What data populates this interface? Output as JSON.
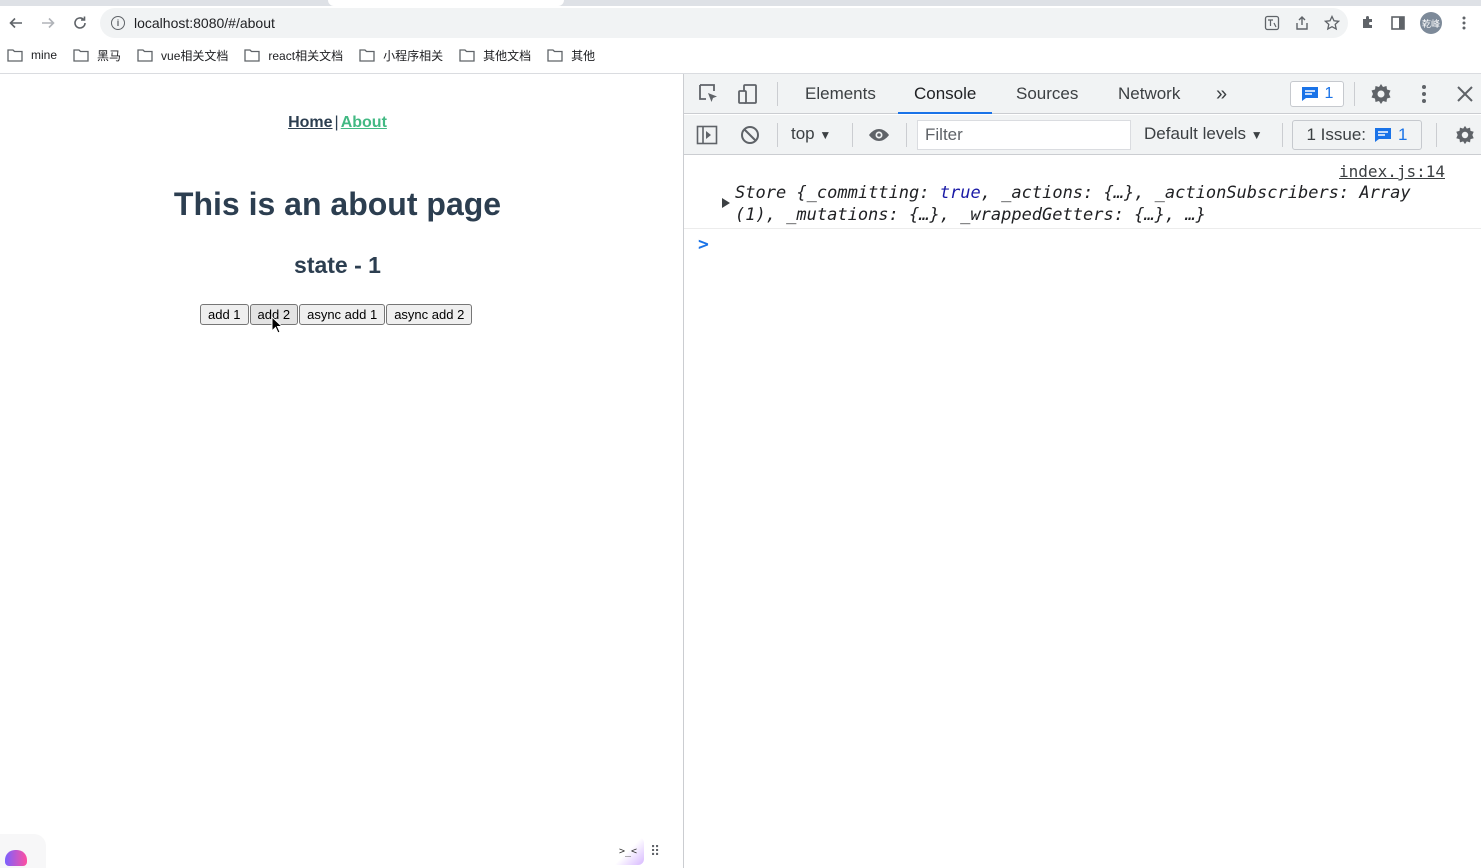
{
  "browser": {
    "url": "localhost:8080/#/about",
    "avatar_text": "乾峰",
    "bookmarks": [
      "mine",
      "黑马",
      "vue相关文档",
      "react相关文档",
      "小程序相关",
      "其他文档",
      "其他"
    ]
  },
  "page": {
    "nav": {
      "home": "Home",
      "separator": "|",
      "about": "About"
    },
    "title": "This is an about page",
    "state_text": "state - 1",
    "buttons": {
      "add1": "add 1",
      "add2": "add 2",
      "async_add1": "async add 1",
      "async_add2": "async add 2"
    },
    "widget_face": ">_<"
  },
  "devtools": {
    "tabs": {
      "elements": "Elements",
      "console": "Console",
      "sources": "Sources",
      "network": "Network",
      "more": "»"
    },
    "message_count": "1",
    "context": "top",
    "filter_placeholder": "Filter",
    "levels": "Default levels",
    "issues_label": "1 Issue:",
    "issues_count": "1",
    "log": {
      "source": "index.js:14",
      "line1_prefix": "Store {",
      "line1_k1": "_committing",
      "line1_v1": "true",
      "line1_rest": ", _actions: {…}, _actionSubscribers: Array",
      "line2": "(1), _mutations: {…}, _wrappedGetters: {…}, …}"
    },
    "prompt": ">"
  },
  "colors": {
    "accent": "#1a73e8",
    "router_active": "#42b983",
    "text_dark": "#2c3e50"
  }
}
